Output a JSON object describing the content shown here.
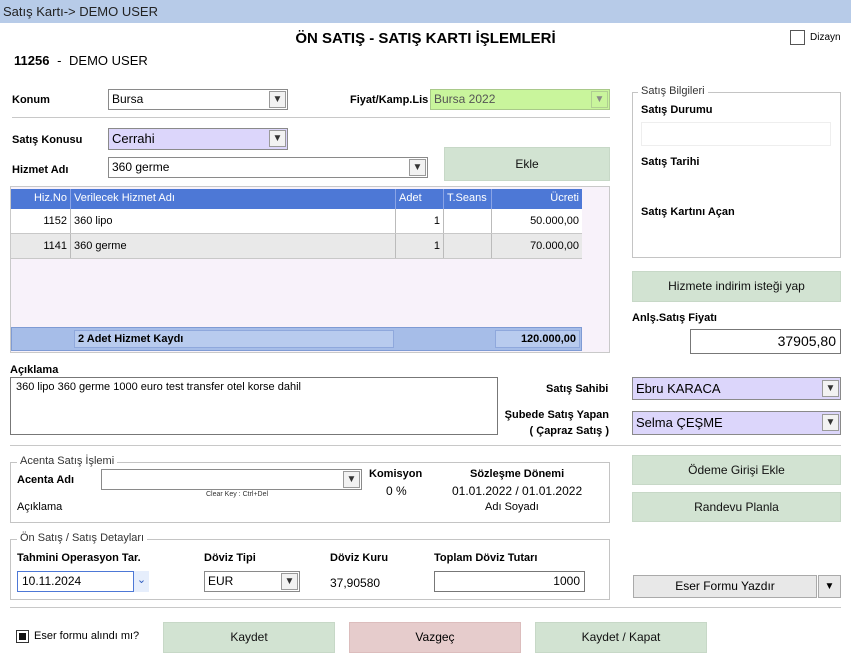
{
  "window": {
    "title": "Satış Kartı-> DEMO USER"
  },
  "header": {
    "title": "ÖN SATIŞ - SATIŞ KARTI İŞLEMLERİ",
    "user_id": "11256",
    "separator": "-",
    "user_name": "DEMO USER",
    "dizayn_label": "Dizayn"
  },
  "form": {
    "konum_label": "Konum",
    "konum_value": "Bursa",
    "fiyat_label": "Fiyat/Kamp.Lis",
    "fiyat_value": "Bursa 2022",
    "satis_konusu_label": "Satış Konusu",
    "satis_konusu_value": "Cerrahi",
    "hizmet_adi_label": "Hizmet Adı",
    "hizmet_adi_value": "360 germe",
    "ekle_label": "Ekle"
  },
  "grid": {
    "columns": [
      "Hiz.No",
      "Verilecek Hizmet Adı",
      "Adet",
      "T.Seans",
      "Ücreti"
    ],
    "rows": [
      {
        "no": "1152",
        "name": "360 lipo",
        "adet": "1",
        "seans": "",
        "ucret": "50.000,00"
      },
      {
        "no": "1141",
        "name": "360 germe",
        "adet": "1",
        "seans": "",
        "ucret": "70.000,00"
      }
    ],
    "footer_count": "2 Adet Hizmet Kaydı",
    "footer_total": "120.000,00"
  },
  "aciklama": {
    "label": "Açıklama",
    "value": "360 lipo 360 germe 1000 euro test transfer otel korse dahil"
  },
  "satis_bilgileri": {
    "legend": "Satış Bilgileri",
    "durum_label": "Satış Durumu",
    "durum_value": "",
    "tarih_label": "Satış Tarihi",
    "acan_label": "Satış Kartını Açan"
  },
  "indirim_button": "Hizmete indirim isteği yap",
  "anls_fiyat": {
    "label": "Anlş.Satış Fiyatı",
    "value": "37905,80"
  },
  "satis_sahibi": {
    "label": "Satış Sahibi",
    "value": "Ebru KARACA"
  },
  "subede": {
    "label1": "Şubede Satış Yapan",
    "label2": "( Çapraz Satış )",
    "value": "Selma ÇEŞME"
  },
  "acenta": {
    "legend": "Acenta Satış İşlemi",
    "adi_label": "Acenta Adı",
    "adi_value": "",
    "clear_key": "Clear Key : Ctrl+Del",
    "komisyon_label": "Komisyon",
    "komisyon_value": "0 %",
    "sozlesme_label": "Sözleşme Dönemi",
    "sozlesme_value": "01.01.2022 / 01.01.2022",
    "aciklama_label": "Açıklama",
    "adi_soyadi_label": "Adı Soyadı"
  },
  "odeme_button": "Ödeme Girişi Ekle",
  "randevu_button": "Randevu Planla",
  "detay": {
    "legend": "Ön Satış / Satış Detayları",
    "op_tar_label": "Tahmini Operasyon Tar.",
    "op_tar_value": "10.11.2024",
    "doviz_tipi_label": "Döviz Tipi",
    "doviz_tipi_value": "EUR",
    "doviz_kuru_label": "Döviz Kuru",
    "doviz_kuru_value": "37,90580",
    "toplam_label": "Toplam Döviz Tutarı",
    "toplam_value": "1000"
  },
  "eser_yazdir_button": "Eser Formu Yazdır",
  "eser_alindi_label": "Eser formu alındı mı?",
  "footer_buttons": {
    "kaydet": "Kaydet",
    "vazgec": "Vazgeç",
    "kaydet_kapat": "Kaydet / Kapat"
  },
  "colors": {
    "titlebar": "#b7cbe8",
    "grid_header": "#4d78d6",
    "button_green": "#d2e3d2",
    "button_pink": "#e6cccc",
    "combo_lavender": "#dcd6fb",
    "combo_green": "#c9f59c"
  }
}
